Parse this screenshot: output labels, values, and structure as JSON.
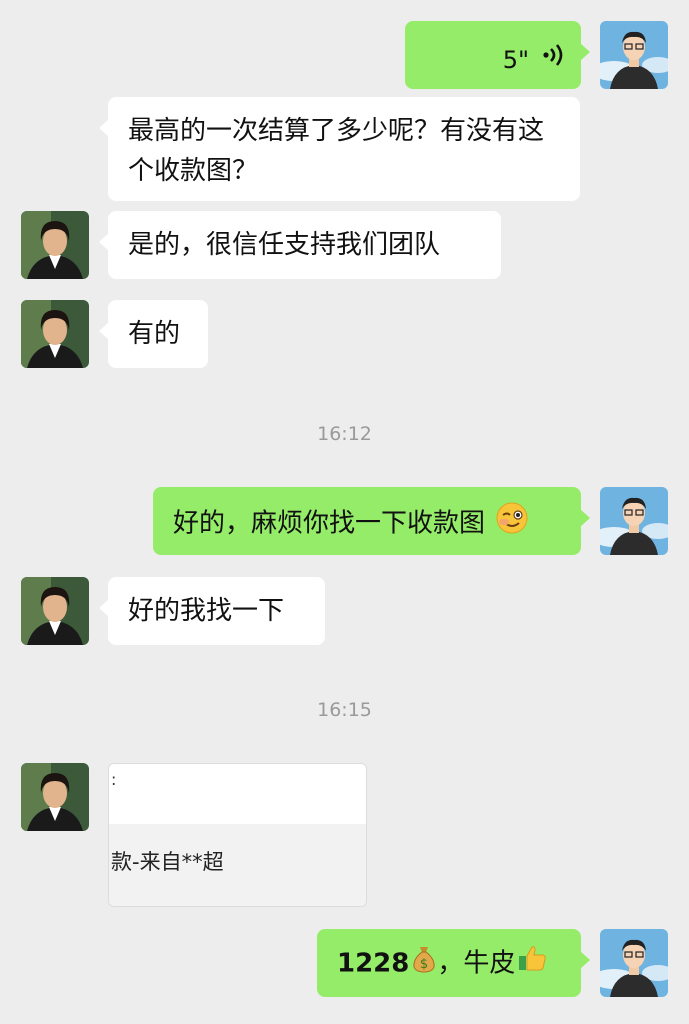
{
  "messages": {
    "voice": {
      "duration": "5\""
    },
    "m1": {
      "text": "最高的一次结算了多少呢？有没有这个收款图？"
    },
    "m2": {
      "text": "是的，很信任支持我们团队"
    },
    "m3": {
      "text": "有的"
    },
    "t1": {
      "time": "16:12"
    },
    "m4": {
      "text": "好的，麻烦你找一下收款图"
    },
    "m5": {
      "text": "好的我找一下"
    },
    "t2": {
      "time": "16:15"
    },
    "card": {
      "top_text": ":",
      "caption": "款-来自**超"
    },
    "m6": {
      "number": "1228",
      "text": "，牛皮"
    }
  },
  "icons": {
    "voice": "voice-wave-icon",
    "wink": "wink-emoji-icon",
    "money": "money-bag-emoji-icon",
    "thumbs": "thumbs-up-emoji-icon"
  },
  "colors": {
    "self_bubble": "#95ec69",
    "other_bubble": "#ffffff",
    "background": "#ededed"
  }
}
